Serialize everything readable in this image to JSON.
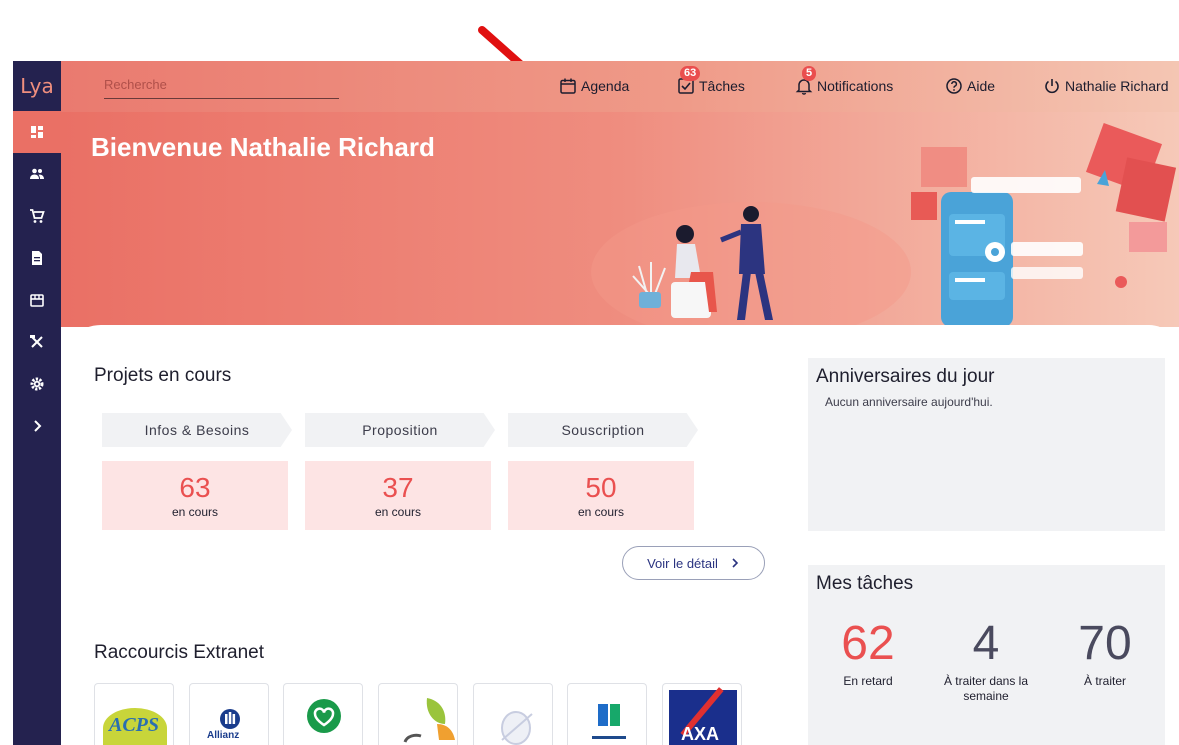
{
  "app": {
    "logo": "Lya"
  },
  "topbar": {
    "search_placeholder": "Recherche",
    "agenda_label": "Agenda",
    "tasks_label": "Tâches",
    "tasks_badge": "63",
    "notifications_label": "Notifications",
    "notifications_badge": "5",
    "help_label": "Aide",
    "user_label": "Nathalie Richard"
  },
  "sidebar": {
    "items": [
      {
        "icon": "dashboard-icon"
      },
      {
        "icon": "users-icon"
      },
      {
        "icon": "cart-icon"
      },
      {
        "icon": "document-icon"
      },
      {
        "icon": "store-icon"
      },
      {
        "icon": "tools-icon"
      },
      {
        "icon": "gear-icon"
      },
      {
        "icon": "chevron-right-icon"
      }
    ]
  },
  "hero": {
    "title": "Bienvenue Nathalie Richard"
  },
  "projects": {
    "title": "Projets en cours",
    "stages": [
      {
        "label": "Infos & Besoins",
        "count": "63",
        "sublabel": "en cours"
      },
      {
        "label": "Proposition",
        "count": "37",
        "sublabel": "en cours"
      },
      {
        "label": "Souscription",
        "count": "50",
        "sublabel": "en cours"
      }
    ],
    "detail_button": "Voir le détail"
  },
  "birthdays": {
    "title": "Anniversaires du jour",
    "empty_text": "Aucun anniversaire aujourd'hui."
  },
  "tasks": {
    "title": "Mes tâches",
    "items": [
      {
        "value": "62",
        "label": "En retard",
        "color": "#ea5050"
      },
      {
        "value": "4",
        "label": "À traiter dans la semaine",
        "color": "#4a4a5e"
      },
      {
        "value": "70",
        "label": "À traiter",
        "color": "#4a4a5e"
      }
    ]
  },
  "shortcuts": {
    "title": "Raccourcis Extranet",
    "tiles": [
      {
        "logo_text": "ACPS"
      },
      {
        "logo_text": "Allianz"
      },
      {
        "logo_text": ""
      },
      {
        "logo_text": ""
      },
      {
        "logo_text": ""
      },
      {
        "logo_text": ""
      },
      {
        "logo_text": "AXA"
      }
    ]
  }
}
